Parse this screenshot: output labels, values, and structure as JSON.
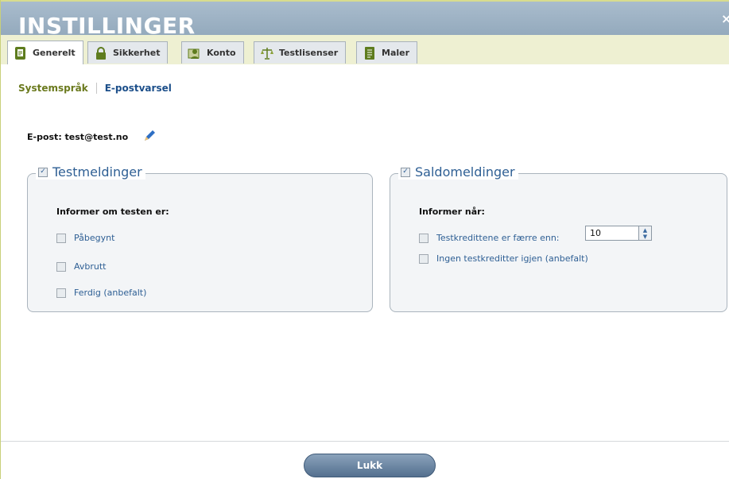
{
  "dialog": {
    "title": "INSTILLINGER",
    "close_glyph": "×"
  },
  "tabs": [
    {
      "label": "Generelt",
      "icon": "document-icon",
      "active": true
    },
    {
      "label": "Sikkerhet",
      "icon": "lock-icon"
    },
    {
      "label": "Konto",
      "icon": "user-card-icon"
    },
    {
      "label": "Testlisenser",
      "icon": "scales-icon"
    },
    {
      "label": "Maler",
      "icon": "template-icon"
    }
  ],
  "subnav": {
    "systemsprak": "Systemspråk",
    "epostvarsel": "E-postvarsel"
  },
  "email": {
    "text": "E-post: test@test.no",
    "edit_icon": "pencil-icon"
  },
  "testmeldinger": {
    "legend": "Testmeldinger",
    "checked": true,
    "heading": "Informer om testen er:",
    "options": [
      "Påbegynt",
      "Avbrutt",
      "Ferdig (anbefalt)"
    ]
  },
  "saldomeldinger": {
    "legend": "Saldomeldinger",
    "checked": true,
    "heading": "Informer når:",
    "option1": "Testkredittene er færre enn:",
    "option1_value": "10",
    "option2": "Ingen testkreditter igjen (anbefalt)"
  },
  "footer": {
    "close_button": "Lukk"
  },
  "colors": {
    "title_bar": "#a9bccd",
    "accent_blue": "#2e5f94",
    "tab_bar": "#eef0d2",
    "button": "#54708f"
  }
}
